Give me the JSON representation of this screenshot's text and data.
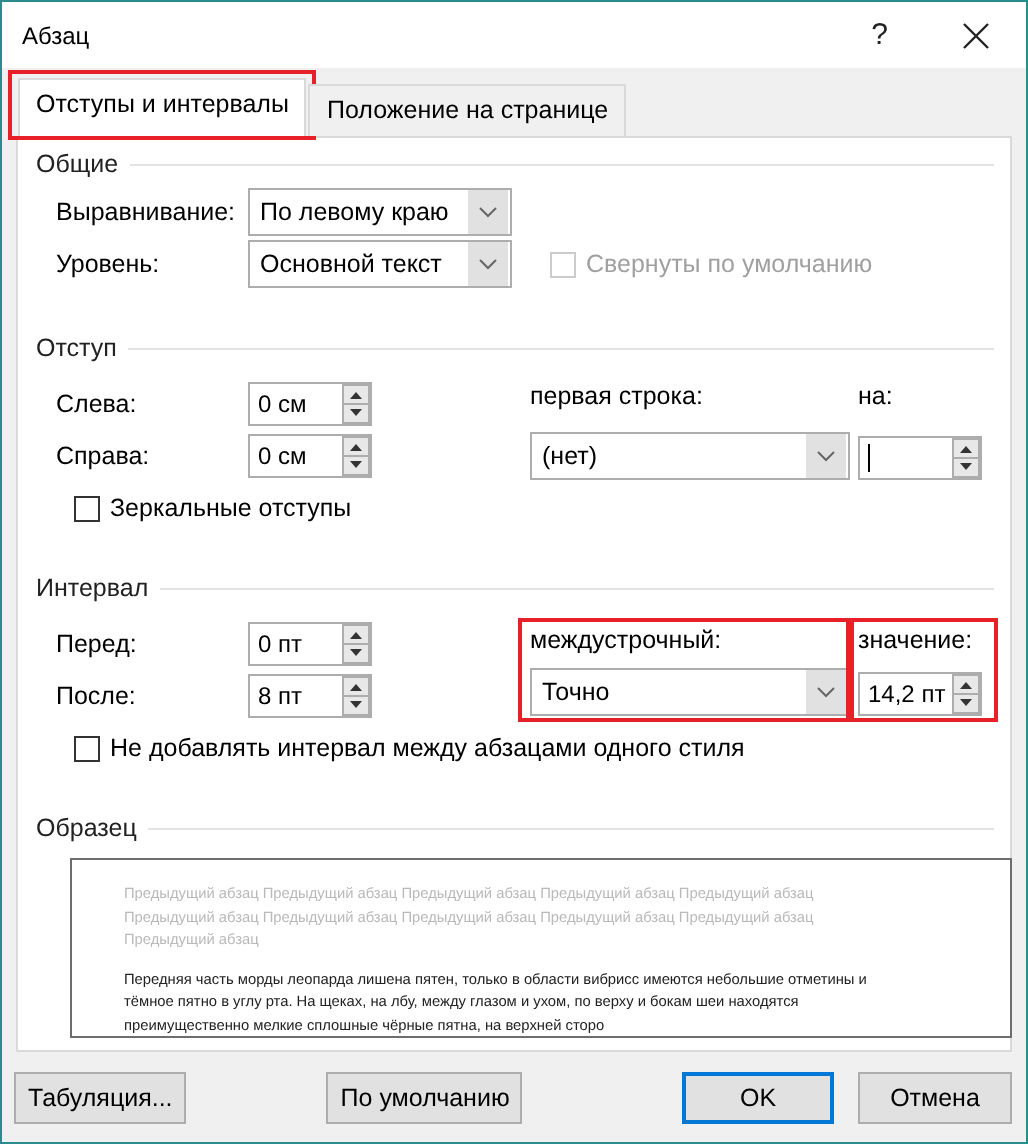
{
  "window": {
    "title": "Абзац",
    "help": "?"
  },
  "tabs": [
    {
      "label": "Отступы и интервалы",
      "selected": true,
      "highlighted": true
    },
    {
      "label": "Положение на странице",
      "selected": false,
      "highlighted": false
    }
  ],
  "general": {
    "title": "Общие",
    "alignment": {
      "label": "Выравнивание:",
      "value": "По левому краю"
    },
    "level": {
      "label": "Уровень:",
      "value": "Основной текст"
    },
    "collapsed": {
      "label": "Свернуты по умолчанию",
      "checked": false,
      "disabled": true
    }
  },
  "indent": {
    "title": "Отступ",
    "left": {
      "label": "Слева:",
      "value": "0 см"
    },
    "right": {
      "label": "Справа:",
      "value": "0 см"
    },
    "first_line": {
      "label": "первая строка:",
      "value": "(нет)"
    },
    "by": {
      "label": "на:",
      "focused": true
    },
    "mirror": {
      "label": "Зеркальные отступы",
      "checked": false
    }
  },
  "spacing": {
    "title": "Интервал",
    "before": {
      "label": "Перед:",
      "value": "0 пт"
    },
    "after": {
      "label": "После:",
      "value": "8 пт"
    },
    "line_spacing": {
      "label": "междустрочный:",
      "value": "Точно",
      "highlighted": true
    },
    "at": {
      "label": "значение:",
      "value": "14,2 пт",
      "highlighted": true
    },
    "dont_add": {
      "label": "Не добавлять интервал между абзацами одного стиля",
      "checked": false
    }
  },
  "preview": {
    "title": "Образец",
    "previous_lines": [
      "Предыдущий абзац Предыдущий абзац Предыдущий абзац Предыдущий абзац Предыдущий абзац",
      "Предыдущий абзац Предыдущий абзац Предыдущий абзац Предыдущий абзац Предыдущий абзац",
      "Предыдущий абзац"
    ],
    "sample_lines": [
      "Передняя часть морды леопарда лишена пятен, только в области вибрисс имеются небольшие отметины и",
      "тёмное пятно в углу рта. На щеках, на лбу, между глазом и ухом, по верху и бокам шеи находятся",
      "преимущественно мелкие сплошные чёрные пятна, на верхней сторо"
    ]
  },
  "buttons": [
    {
      "label": "Табуляция...",
      "default": false
    },
    {
      "label": "По умолчанию",
      "default": false
    },
    {
      "label": "OK",
      "default": true
    },
    {
      "label": "Отмена",
      "default": false
    }
  ]
}
